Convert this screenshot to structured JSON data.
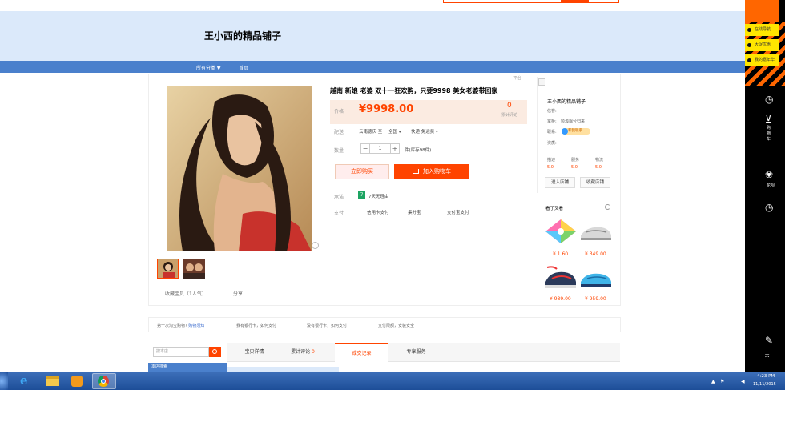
{
  "header": {
    "shop_name": "王小西的精品铺子",
    "nav": {
      "all_categories": "所有分类 ▼",
      "home": "首页"
    }
  },
  "product": {
    "title": "越南 新娘 老婆 双十一狂欢购，只要9998 美女老婆带回家",
    "corner_label": "平台",
    "price_label": "价格",
    "price": "¥9998.00",
    "review_count": "0",
    "review_label": "累计评论",
    "delivery_label": "配送",
    "delivery_from": "云南德庆 至",
    "delivery_to": "全国 ▾",
    "delivery_fee": "快递 免运费 ▾",
    "quantity_label": "数量",
    "quantity": "1",
    "qty_minus": "−",
    "qty_plus": "+",
    "stock": "件(库存98件)",
    "buy_now": "立即购买",
    "add_to_cart": "加入购物车",
    "promise_label": "承诺",
    "promise_badge": "7",
    "promise_text": "7天无理由",
    "payment_label": "支付",
    "payment_methods": [
      "信用卡支付",
      "集分宝",
      "支付宝支付"
    ],
    "favorite": "收藏宝贝（1人气）",
    "share": "分享"
  },
  "shop_panel": {
    "name": "王小西的精品铺子",
    "credit_label": "信誉:",
    "seller_label": "掌柜:",
    "seller_name": "颖浅飘兮归来",
    "contact_label": "联系:",
    "contact_badge": "和我联系",
    "qualification_label": "资质:",
    "ratings": [
      {
        "label": "描述",
        "value": "5.0"
      },
      {
        "label": "服务",
        "value": "5.0"
      },
      {
        "label": "物流",
        "value": "5.0"
      }
    ],
    "enter_shop": "进入店铺",
    "fav_shop": "收藏店铺",
    "seen_title": "看了又看",
    "seen_items": [
      {
        "price": "¥ 1.60"
      },
      {
        "price": "¥ 349.00"
      },
      {
        "price": "¥ 989.00"
      },
      {
        "price": "¥ 959.00"
      }
    ]
  },
  "tips": {
    "first_time": "第一次淘宝购物?",
    "guide_link": "购物须知",
    "tip1": "我有银行卡，如何支付",
    "tip2": "没有银行卡，如何支付",
    "tip3": "支付限额，安装安全"
  },
  "tabs": {
    "search_placeholder": "搜本店",
    "shop_categories": "本店搜索",
    "items": [
      "宝贝详情",
      "累计评论",
      "成交记录",
      "专享服务"
    ],
    "review_badge": "0"
  },
  "sidebar": {
    "links": [
      "在线导航",
      "大促优惠",
      "我的嘉年华"
    ],
    "cart_label": "购物车",
    "flower_label": "花呗"
  },
  "taskbar": {
    "time": "4:23 PM",
    "date": "11/11/2015",
    "ie_glyph": "e",
    "tray_up": "▲",
    "tray_flag": "⚑",
    "tray_volume": "◀"
  },
  "colors": {
    "accent": "#ff4400",
    "nav_blue": "#4a80cc",
    "banner": "#dbe9fa"
  }
}
